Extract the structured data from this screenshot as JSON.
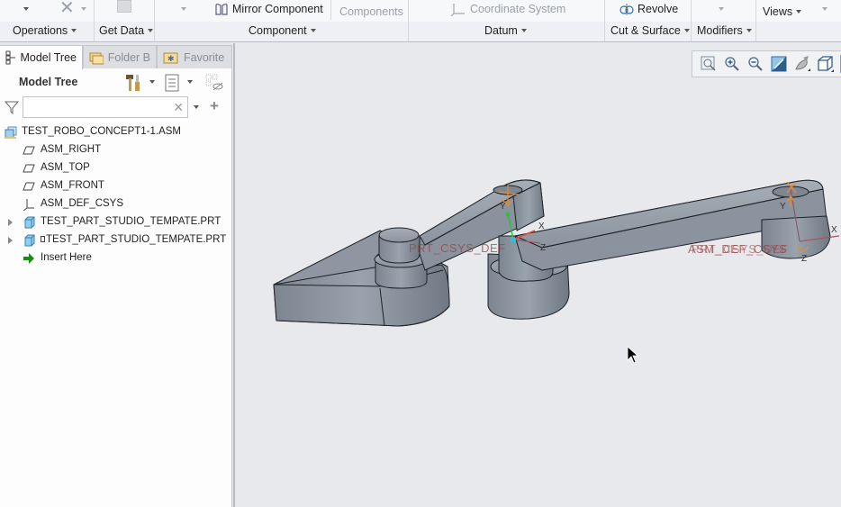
{
  "ribbon": {
    "buttons": {
      "mirror_component": "Mirror Component",
      "components": "Components",
      "coordinate_system": "Coordinate System",
      "revolve": "Revolve",
      "views": "Views"
    },
    "groups": {
      "operations": "Operations",
      "get_data": "Get Data",
      "component": "Component",
      "datum": "Datum",
      "cut_surface": "Cut & Surface",
      "modifiers": "Modifiers"
    }
  },
  "panel": {
    "tabs": [
      {
        "label": "Model Tree",
        "icon": "model-tree-icon",
        "active": true
      },
      {
        "label": "Folder B",
        "icon": "folder-icon",
        "active": false
      },
      {
        "label": "Favorite",
        "icon": "favorites-icon",
        "active": false
      }
    ],
    "title": "Model Tree",
    "search": {
      "value": "",
      "placeholder": ""
    },
    "tree": [
      {
        "label": "TEST_ROBO_CONCEPT1-1.ASM",
        "icon": "assembly-icon",
        "indent": 0,
        "expandable": false
      },
      {
        "label": "ASM_RIGHT",
        "icon": "datum-plane-icon",
        "indent": 1,
        "expandable": false
      },
      {
        "label": "ASM_TOP",
        "icon": "datum-plane-icon",
        "indent": 1,
        "expandable": false
      },
      {
        "label": "ASM_FRONT",
        "icon": "datum-plane-icon",
        "indent": 1,
        "expandable": false
      },
      {
        "label": "ASM_DEF_CSYS",
        "icon": "csys-icon",
        "indent": 1,
        "expandable": false
      },
      {
        "label": "TEST_PART_STUDIO_TEMPATE.PRT",
        "icon": "part-icon",
        "indent": 1,
        "expandable": true
      },
      {
        "label": "TEST_PART_STUDIO_TEMPATE.PRT",
        "icon": "part-icon",
        "indent": 1,
        "expandable": true,
        "marker": true
      },
      {
        "label": "Insert Here",
        "icon": "insert-arrow-icon",
        "indent": 1,
        "expandable": false
      }
    ]
  },
  "viewport": {
    "annotations": {
      "csys1": "PRT_CSYS_DEF",
      "csys2": "ASM_DEF_CSYS",
      "csys2_overlap": "PRT_CSYS_DEF"
    },
    "axis_labels": {
      "x": "X",
      "y": "Y",
      "z": "Z"
    }
  },
  "colors": {
    "model_fill": "#8a929e",
    "model_edge": "#1d2128",
    "axis_x": "#e24c3c",
    "axis_y": "#2bc13a",
    "axis_z": "#25c6d8",
    "csys_orange": "#f08a2a"
  }
}
